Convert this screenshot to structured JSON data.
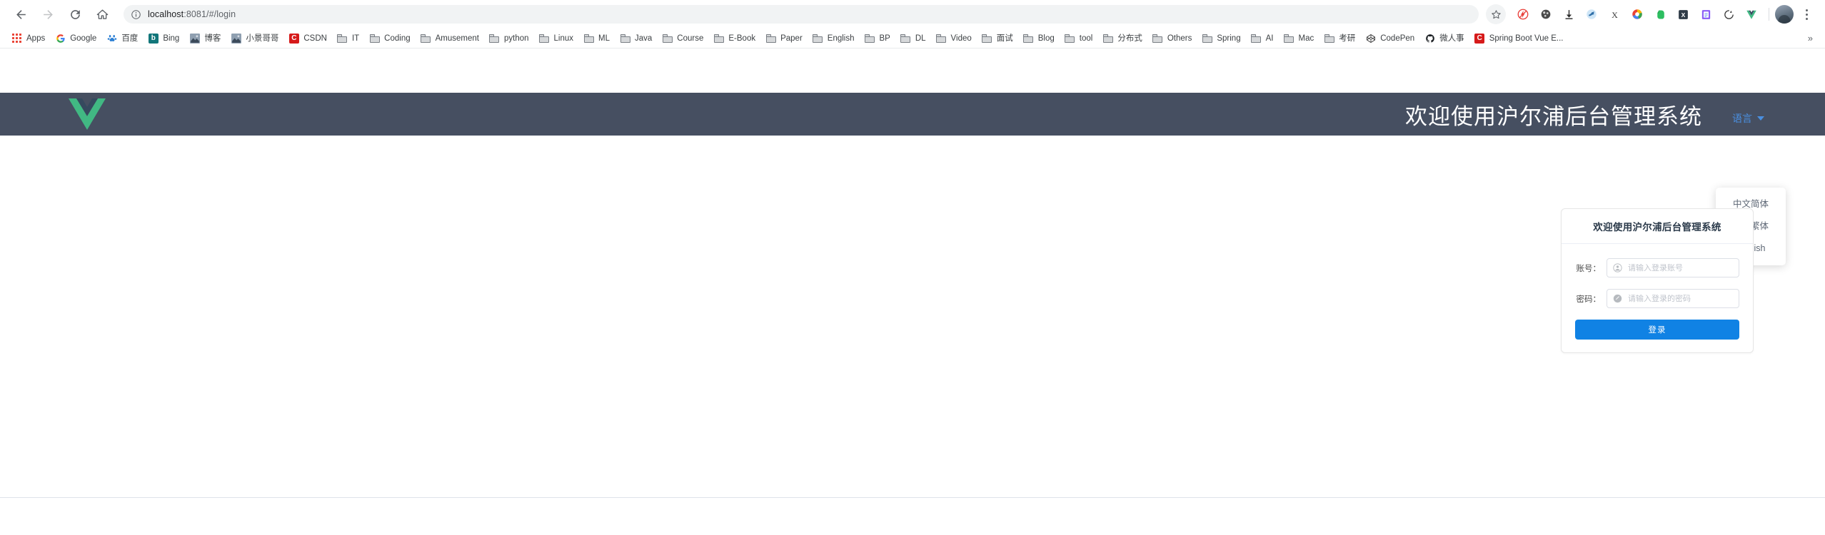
{
  "browser": {
    "url_host": "localhost",
    "url_path": ":8081/#/login",
    "nav": {
      "back": "Back",
      "forward": "Forward",
      "reload": "Reload",
      "home": "Home"
    },
    "toolbar_icons": [
      {
        "name": "bookmark-star-icon",
        "glyph": "star"
      },
      {
        "name": "flash-block-icon",
        "glyph": "flash"
      },
      {
        "name": "video-downloader-icon",
        "glyph": "reel"
      },
      {
        "name": "download-icon",
        "glyph": "arrow-down"
      },
      {
        "name": "bird-extension-icon",
        "glyph": "bird"
      },
      {
        "name": "x-extension-icon",
        "glyph": "X"
      },
      {
        "name": "color-ring-extension-icon",
        "glyph": "ring"
      },
      {
        "name": "evernote-icon",
        "glyph": "elephant"
      },
      {
        "name": "x-dark-extension-icon",
        "glyph": "x-box"
      },
      {
        "name": "notes-extension-icon",
        "glyph": "notes"
      },
      {
        "name": "sync-extension-icon",
        "glyph": "sync"
      },
      {
        "name": "vue-devtools-icon",
        "glyph": "vue"
      }
    ],
    "bookmarks": [
      {
        "label": "Apps",
        "icon": "apps-grid-icon"
      },
      {
        "label": "Google",
        "icon": "google-icon"
      },
      {
        "label": "百度",
        "icon": "baidu-icon"
      },
      {
        "label": "Bing",
        "icon": "bing-icon"
      },
      {
        "label": "博客",
        "icon": "photo-icon"
      },
      {
        "label": "小景哥哥",
        "icon": "photo-icon"
      },
      {
        "label": "CSDN",
        "icon": "csdn-icon"
      },
      {
        "label": "IT",
        "icon": "folder-icon"
      },
      {
        "label": "Coding",
        "icon": "folder-icon"
      },
      {
        "label": "Amusement",
        "icon": "folder-icon"
      },
      {
        "label": "python",
        "icon": "folder-icon"
      },
      {
        "label": "Linux",
        "icon": "folder-icon"
      },
      {
        "label": "ML",
        "icon": "folder-icon"
      },
      {
        "label": "Java",
        "icon": "folder-icon"
      },
      {
        "label": "Course",
        "icon": "folder-icon"
      },
      {
        "label": "E-Book",
        "icon": "folder-icon"
      },
      {
        "label": "Paper",
        "icon": "folder-icon"
      },
      {
        "label": "English",
        "icon": "folder-icon"
      },
      {
        "label": "BP",
        "icon": "folder-icon"
      },
      {
        "label": "DL",
        "icon": "folder-icon"
      },
      {
        "label": "Video",
        "icon": "folder-icon"
      },
      {
        "label": "面试",
        "icon": "folder-icon"
      },
      {
        "label": "Blog",
        "icon": "folder-icon"
      },
      {
        "label": "tool",
        "icon": "folder-icon"
      },
      {
        "label": "分布式",
        "icon": "folder-icon"
      },
      {
        "label": "Others",
        "icon": "folder-icon"
      },
      {
        "label": "Spring",
        "icon": "folder-icon"
      },
      {
        "label": "AI",
        "icon": "folder-icon"
      },
      {
        "label": "Mac",
        "icon": "folder-icon"
      },
      {
        "label": "考研",
        "icon": "folder-icon"
      },
      {
        "label": "CodePen",
        "icon": "codepen-icon"
      },
      {
        "label": "微人事",
        "icon": "github-icon"
      },
      {
        "label": "Spring Boot Vue E...",
        "icon": "csdn-icon"
      }
    ],
    "overflow_label": "»"
  },
  "app": {
    "logo_name": "vue-logo",
    "header_title": "欢迎使用沪尔浦后台管理系统",
    "language": {
      "trigger_label": "语言",
      "options": [
        "中文简体",
        "中文繁体",
        "English"
      ]
    },
    "login": {
      "card_title": "欢迎使用沪尔浦后台管理系统",
      "account_label": "账号：",
      "account_value": "",
      "account_placeholder": "请输入登录账号",
      "password_label": "密码：",
      "password_value": "",
      "password_placeholder": "请输入登录的密码",
      "submit_label": "登录"
    }
  },
  "colors": {
    "header_bg": "#464f61",
    "accent_blue": "#1082e4",
    "link_blue": "#4a8fe0",
    "vue_green": "#41b883",
    "vue_dark": "#35495e"
  }
}
